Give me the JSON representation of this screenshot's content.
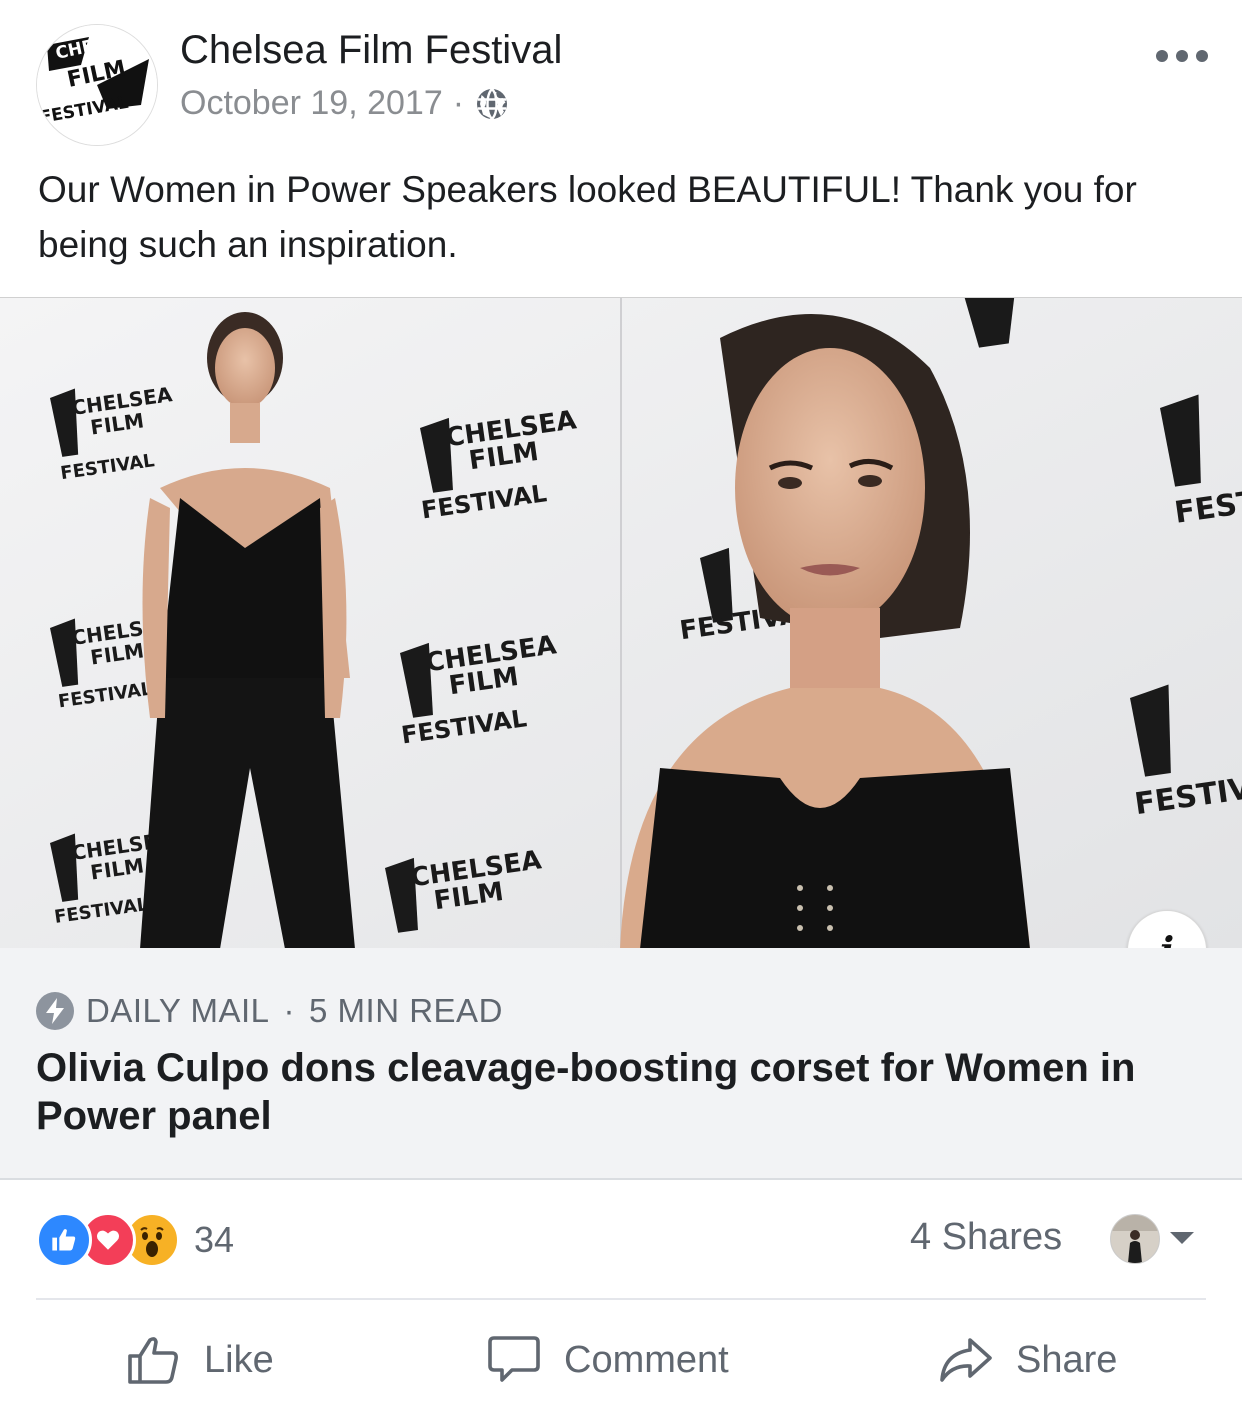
{
  "header": {
    "page_name": "Chelsea Film Festival",
    "date": "October 19, 2017",
    "separator": "·",
    "avatar_logo": {
      "line1": "CHELSEA",
      "line2": "FILM",
      "line3": "FESTIVAL"
    },
    "privacy_icon": "globe-icon",
    "more_icon": "more-options-icon"
  },
  "post": {
    "text": "Our Women in Power Speakers looked BEAUTIFUL! Thank you for being such an inspiration."
  },
  "link_preview": {
    "image_backdrop_text": {
      "line1": "CHELSEA",
      "line2": "FILM",
      "line3": "FESTIVAL"
    },
    "info_icon_label": "i",
    "source": "DAILY MAIL",
    "separator": "·",
    "read_time": "5 MIN READ",
    "title": "Olivia Culpo dons cleavage-boosting corset for Women in Power panel"
  },
  "engagement": {
    "reaction_icons": [
      "like-reaction-icon",
      "love-reaction-icon",
      "wow-reaction-icon"
    ],
    "reaction_count": "34",
    "shares": "4 Shares"
  },
  "actions": {
    "like": "Like",
    "comment": "Comment",
    "share": "Share"
  },
  "colors": {
    "text_primary": "#1c1e21",
    "text_secondary": "#606770",
    "link_meta_bg": "#f2f3f5",
    "like_blue": "#2d88ff",
    "love_red": "#f33e58",
    "wow_yellow": "#f7b125"
  }
}
